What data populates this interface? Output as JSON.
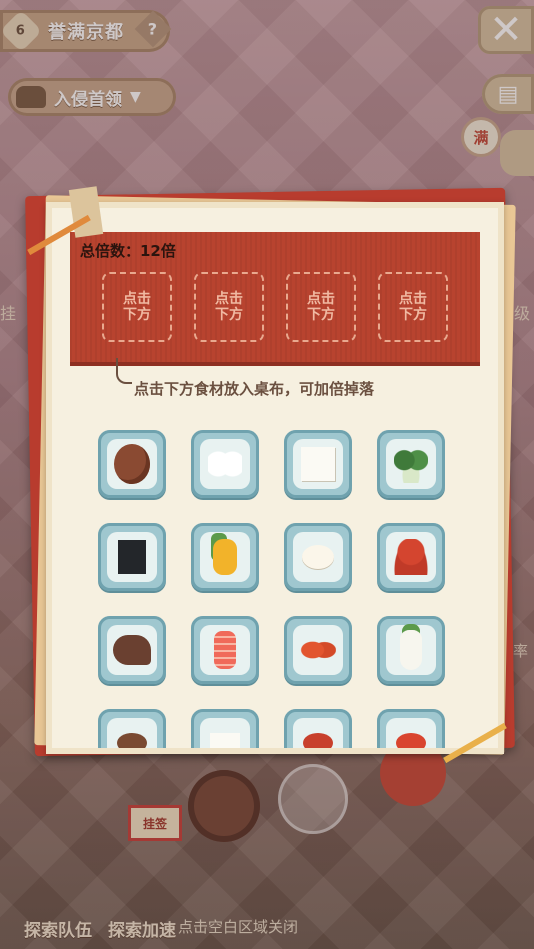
{
  "header": {
    "level": "6",
    "region_name": "誉满京都",
    "help_icon": "?",
    "invade_label": "入侵首领",
    "close_symbol": "✕",
    "full_badge": "满"
  },
  "side": {
    "left_fragment": "挂",
    "right_fragment": "级",
    "right_fragment_2": "率"
  },
  "modal": {
    "multiplier_label": "总倍数：12倍",
    "slots": [
      "点击\n下方",
      "点击\n下方",
      "点击\n下方",
      "点击\n下方"
    ],
    "hint": "点击下方食材放入桌布，可加倍掉落",
    "ingredients": [
      {
        "icon": "meat-patty-icon"
      },
      {
        "icon": "rice-balls-icon"
      },
      {
        "icon": "tofu-icon"
      },
      {
        "icon": "bok-choy-icon"
      },
      {
        "icon": "seaweed-icon"
      },
      {
        "icon": "corn-icon"
      },
      {
        "icon": "egg-icon"
      },
      {
        "icon": "octopus-icon"
      },
      {
        "icon": "eel-icon"
      },
      {
        "icon": "salmon-icon"
      },
      {
        "icon": "shrimp-icon"
      },
      {
        "icon": "daikon-icon"
      },
      {
        "icon": "food-partial-icon"
      },
      {
        "icon": "food-partial-icon"
      },
      {
        "icon": "food-partial-icon"
      },
      {
        "icon": "food-partial-icon"
      }
    ]
  },
  "bottom": {
    "explore_team": "探索队伍",
    "explore_speed": "探索加速",
    "close_hint": "点击空白区域关闭",
    "badge_label": "挂签"
  },
  "colors": {
    "cloth": "#b8432f",
    "paper": "#f6f0e0",
    "tile": "#9fc7cf"
  }
}
